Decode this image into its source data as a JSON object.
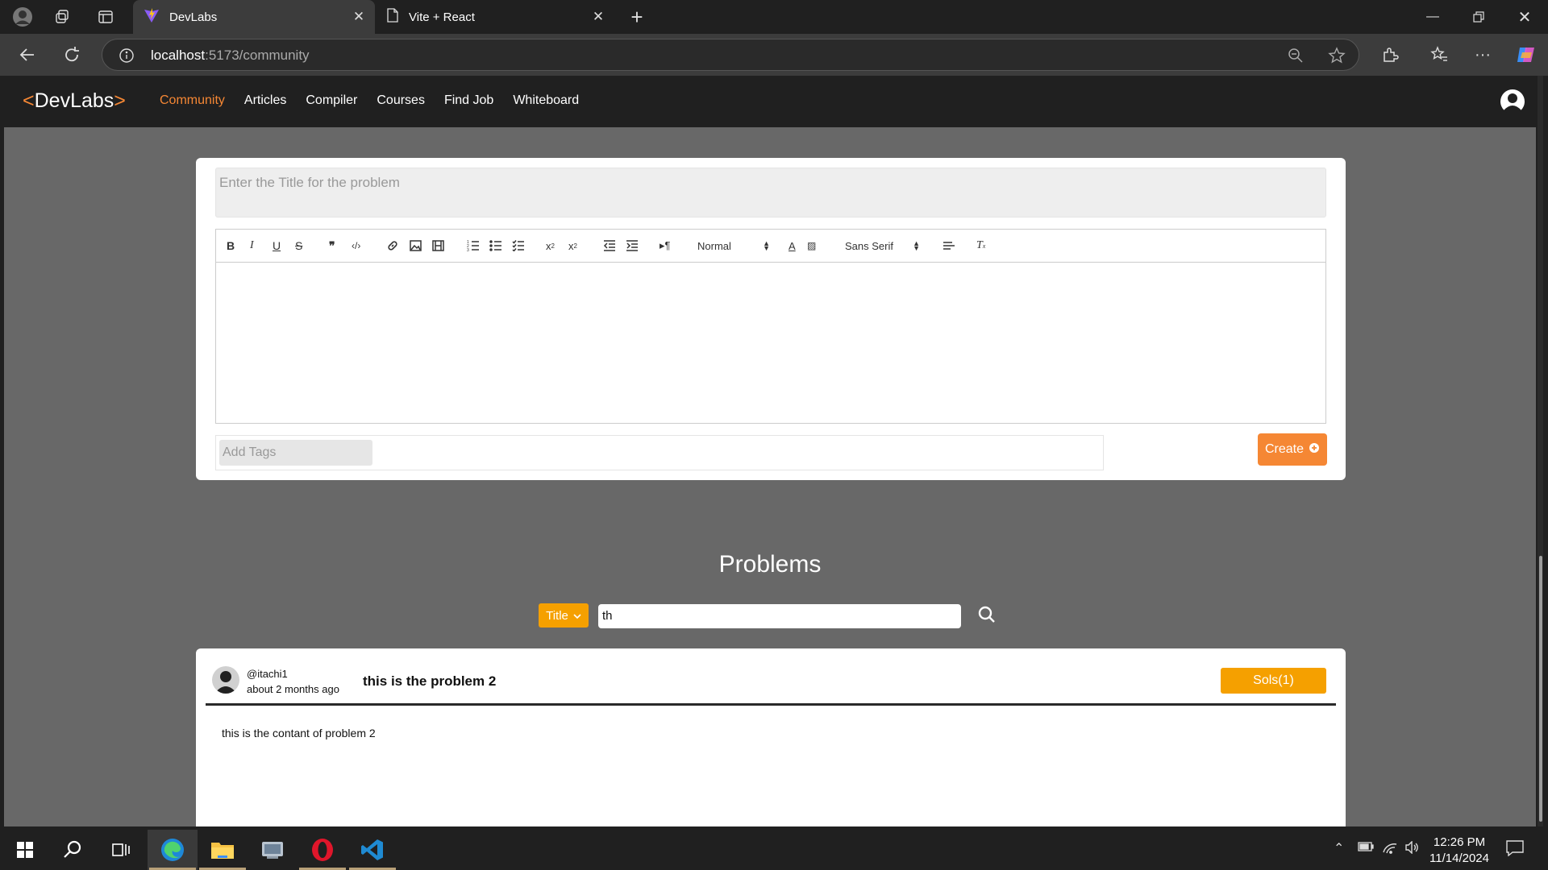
{
  "browser": {
    "tabs": [
      {
        "label": "DevLabs",
        "active": true
      },
      {
        "label": "Vite + React",
        "active": false
      }
    ],
    "url_host": "localhost",
    "url_path": ":5173/community"
  },
  "navbar": {
    "logo_open": "<",
    "logo_text": "DevLabs",
    "logo_close": ">",
    "links": [
      "Community",
      "Articles",
      "Compiler",
      "Courses",
      "Find Job",
      "Whiteboard"
    ]
  },
  "editor": {
    "title_placeholder": "Enter the Title for the problem",
    "header_select": "Normal",
    "font_select": "Sans Serif",
    "tags_placeholder": "Add Tags",
    "create_label": "Create"
  },
  "problems": {
    "heading": "Problems",
    "filter_label": "Title",
    "search_value": "th",
    "items": [
      {
        "user": "@itachi1",
        "time": "about 2 months ago",
        "title": "this is the problem 2",
        "sols_label": "Sols(1)",
        "content": "this is the  contant of problem 2"
      }
    ]
  },
  "taskbar": {
    "time": "12:26 PM",
    "date": "11/14/2024"
  },
  "colors": {
    "accent": "#f58734",
    "sols_button": "#f5a000",
    "page_bg": "#686868",
    "navbar_bg": "#202020"
  }
}
